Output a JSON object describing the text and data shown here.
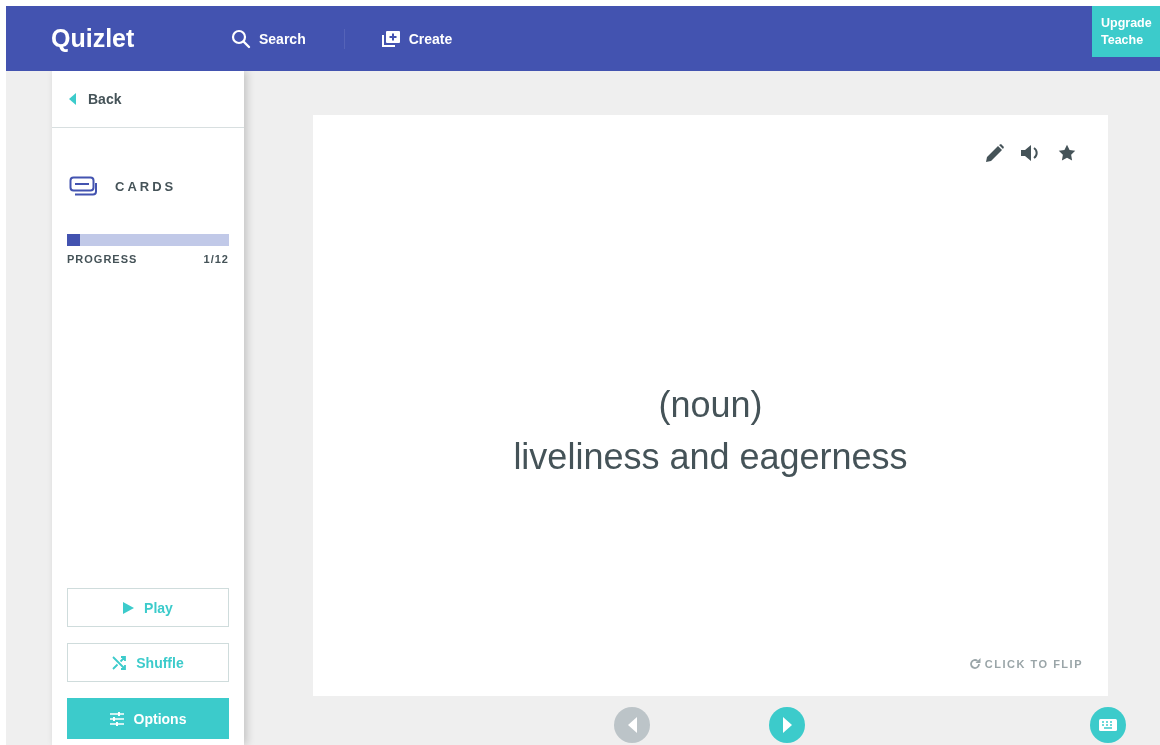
{
  "header": {
    "logo": "Quizlet",
    "search": "Search",
    "create": "Create",
    "upgrade": [
      "Upgrade",
      "Teache"
    ]
  },
  "sidebar": {
    "back": "Back",
    "mode": "CARDS",
    "progress": {
      "label": "PROGRESS",
      "count": "1/12",
      "level": 0.083
    },
    "buttons": [
      {
        "kind": "play",
        "label": "Play"
      },
      {
        "kind": "shuffle",
        "label": "Shuffle"
      },
      {
        "kind": "options",
        "label": "Options"
      }
    ]
  },
  "card": {
    "lines": [
      "(noun)",
      "liveliness and eagerness"
    ],
    "flip": "CLICK TO FLIP",
    "starred": false
  },
  "nav": {
    "prev_disabled": true,
    "next_disabled": false
  }
}
